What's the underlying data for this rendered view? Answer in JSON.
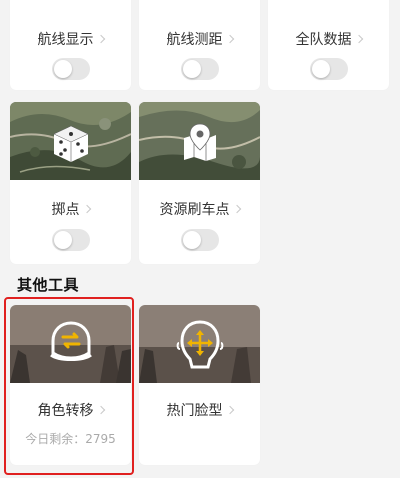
{
  "colors": {
    "background": "#f3f3f3",
    "card": "#ffffff",
    "toggle_off": "#e6e6e6",
    "accent_orange": "#f0b400",
    "highlight_red": "#e0201f"
  },
  "top_row": [
    {
      "label": "航线显示"
    },
    {
      "label": "航线测距"
    },
    {
      "label": "全队数据"
    }
  ],
  "map_tools": [
    {
      "label": "掷点",
      "icon": "dice-icon"
    },
    {
      "label": "资源刷车点",
      "icon": "map-pin-icon"
    }
  ],
  "other_tools": {
    "title": "其他工具",
    "items": [
      {
        "label": "角色转移",
        "icon": "helmet-swap-icon",
        "remaining": "今日剩余：2795"
      },
      {
        "label": "热门脸型",
        "icon": "face-move-icon"
      }
    ]
  }
}
